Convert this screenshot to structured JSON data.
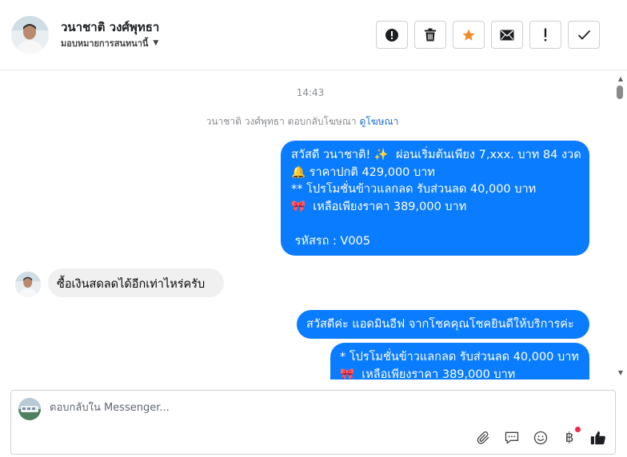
{
  "header": {
    "contact_name": "วนาชาติ วงศ์พุทธา",
    "assign_label": "มอบหมายการสนทนานี้",
    "actions": [
      {
        "name": "report-spam",
        "icon": "alert-circle-icon",
        "glyph": "!"
      },
      {
        "name": "delete",
        "icon": "trash-icon",
        "glyph": "🗑"
      },
      {
        "name": "star",
        "icon": "star-icon",
        "glyph": "★",
        "color": "#f28c28"
      },
      {
        "name": "mark-unread",
        "icon": "envelope-icon",
        "glyph": "✉"
      },
      {
        "name": "follow-up",
        "icon": "exclamation-icon",
        "glyph": "!"
      },
      {
        "name": "mark-done",
        "icon": "check-icon",
        "glyph": "✓"
      }
    ]
  },
  "chat": {
    "timestamp": "14:43",
    "notice_text": "วนาชาติ วงศ์พุทธา ตอบกลับโฆษณา",
    "notice_link": "ดูโฆษณา",
    "messages": [
      {
        "direction": "out",
        "lines": [
          "สวัสดี วนาชาติ! ✨  ผ่อนเริ่มต้นเพียง 7,xxx. บาท 84 งวด",
          "🔔 ราคาปกติ 429,000 บาท",
          "** โปรโมชั่นข้าวแลกลด รับส่วนลด 40,000 บาท",
          "🎀  เหลือเพียงราคา 389,000 บาท",
          "",
          " รหัสรถ : V005"
        ]
      },
      {
        "direction": "in",
        "text": "ซื้อเงินสดลดได้อีกเท่าไหร่ครับ"
      },
      {
        "direction": "out",
        "text": "สวัสดีค่ะ แอดมินอีฟ จากโชคคุณโชคยินดีให้บริการค่ะ"
      },
      {
        "direction": "out",
        "lines": [
          "* โปรโมชั่นข้าวแลกลด รับส่วนลด 40,000 บาท",
          "🎀  เหลือเพียงราคา 389,000 บาท"
        ]
      }
    ]
  },
  "composer": {
    "placeholder": "ตอบกลับใน Messenger...",
    "tools": [
      "paperclip-icon",
      "saved-reply-icon",
      "emoji-icon",
      "baht-payment-icon",
      "thumbs-up-icon"
    ]
  },
  "colors": {
    "accent": "#0a7cff",
    "incoming_bubble": "#f0f0f0",
    "link": "#216fdb",
    "star": "#f28c28",
    "notification_dot": "#f02849"
  }
}
